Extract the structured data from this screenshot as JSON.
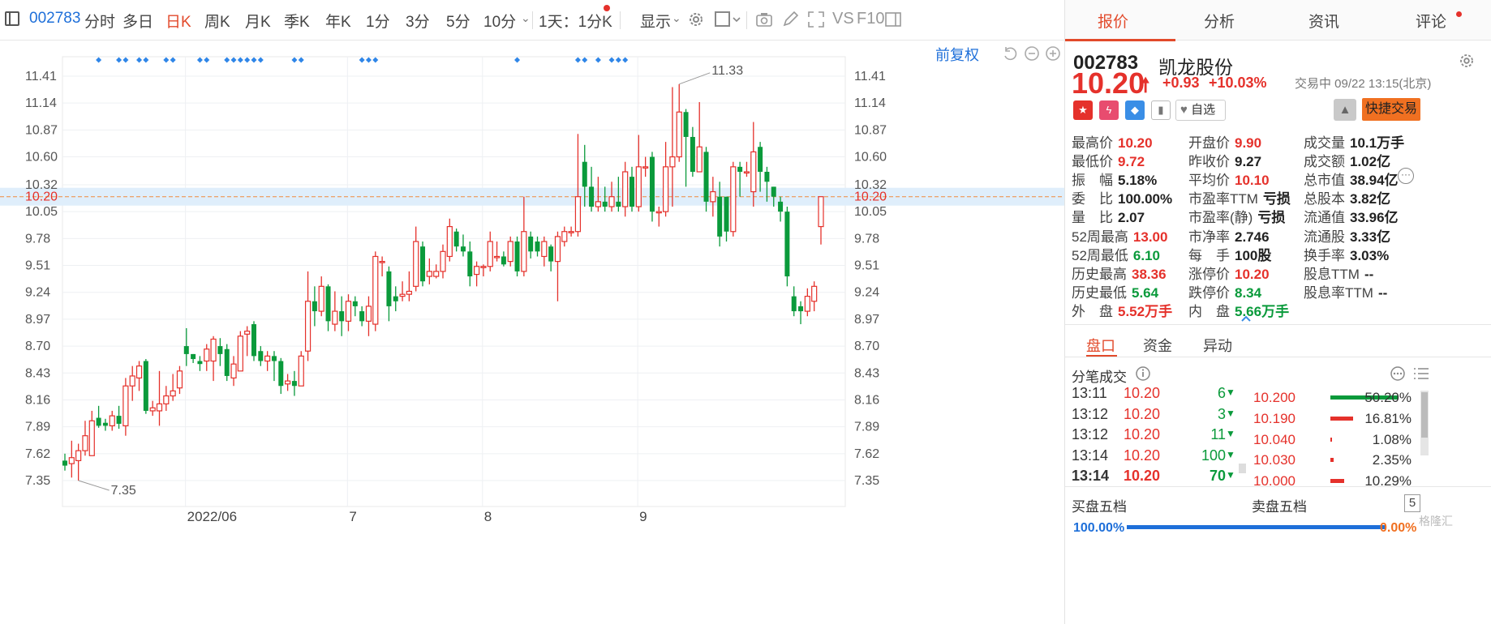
{
  "toolbar": {
    "code": "002783",
    "items": [
      "分时",
      "多日",
      "日K",
      "周K",
      "月K",
      "季K",
      "年K",
      "1分",
      "3分",
      "5分",
      "10分",
      "1天：1分K",
      "显示"
    ],
    "active": "日K",
    "vs_label": "VS",
    "f10_label": "F10",
    "adjust_label": "前复权"
  },
  "chart_data": {
    "type": "candlestick",
    "title": "",
    "y_ticks": [
      11.41,
      11.14,
      10.87,
      10.6,
      10.32,
      10.05,
      9.78,
      9.51,
      9.24,
      8.97,
      8.7,
      8.43,
      8.16,
      7.89,
      7.62,
      7.35
    ],
    "ylim": [
      7.22,
      11.58
    ],
    "x_labels": [
      "2022/06",
      "7",
      "8",
      "9"
    ],
    "current_price_line": 10.2,
    "high_annotation": "11.33",
    "low_annotation": "7.35",
    "grid": true,
    "candles": [
      [
        7.55,
        7.5,
        7.62,
        7.45
      ],
      [
        7.52,
        7.58,
        7.75,
        7.38
      ],
      [
        7.55,
        7.65,
        7.72,
        7.35
      ],
      [
        7.65,
        7.8,
        7.95,
        7.6
      ],
      [
        7.6,
        7.95,
        8.05,
        7.6
      ],
      [
        7.98,
        7.9,
        8.1,
        7.88
      ],
      [
        7.93,
        7.9,
        7.97,
        7.85
      ],
      [
        7.9,
        8.0,
        8.05,
        7.85
      ],
      [
        8.0,
        7.92,
        8.1,
        7.87
      ],
      [
        7.9,
        8.3,
        8.38,
        7.8
      ],
      [
        8.3,
        8.4,
        8.5,
        8.15
      ],
      [
        8.38,
        8.5,
        8.55,
        8.25
      ],
      [
        8.55,
        8.05,
        8.57,
        8.02
      ],
      [
        8.05,
        8.08,
        8.15,
        8.0
      ],
      [
        8.05,
        8.12,
        8.45,
        7.9
      ],
      [
        8.12,
        8.2,
        8.3,
        8.05
      ],
      [
        8.2,
        8.25,
        8.42,
        8.15
      ],
      [
        8.28,
        8.45,
        8.5,
        8.22
      ],
      [
        8.7,
        8.62,
        8.88,
        8.5
      ],
      [
        8.62,
        8.57,
        8.62,
        8.53
      ],
      [
        8.55,
        8.52,
        8.6,
        8.45
      ],
      [
        8.55,
        8.67,
        8.72,
        8.45
      ],
      [
        8.55,
        8.77,
        8.8,
        8.35
      ],
      [
        8.7,
        8.62,
        8.78,
        8.5
      ],
      [
        8.67,
        8.4,
        8.72,
        8.35
      ],
      [
        8.38,
        8.52,
        8.6,
        8.3
      ],
      [
        8.45,
        8.8,
        8.85,
        8.45
      ],
      [
        8.82,
        8.85,
        8.9,
        8.6
      ],
      [
        8.92,
        8.6,
        8.95,
        8.55
      ],
      [
        8.65,
        8.55,
        8.7,
        8.5
      ],
      [
        8.55,
        8.6,
        8.65,
        8.45
      ],
      [
        8.6,
        8.55,
        8.65,
        8.35
      ],
      [
        8.55,
        8.3,
        8.58,
        8.22
      ],
      [
        8.32,
        8.35,
        8.42,
        8.25
      ],
      [
        8.35,
        8.3,
        8.45,
        8.2
      ],
      [
        8.3,
        8.6,
        8.65,
        8.3
      ],
      [
        8.65,
        9.15,
        9.45,
        8.55
      ],
      [
        9.15,
        9.05,
        9.3,
        8.9
      ],
      [
        9.05,
        9.3,
        9.4,
        9.0
      ],
      [
        9.3,
        8.95,
        9.32,
        8.85
      ],
      [
        8.92,
        9.05,
        9.25,
        8.85
      ],
      [
        9.05,
        8.95,
        9.2,
        8.8
      ],
      [
        8.95,
        9.15,
        9.22,
        8.85
      ],
      [
        9.15,
        9.1,
        9.2,
        9.0
      ],
      [
        9.05,
        8.95,
        9.1,
        8.9
      ],
      [
        8.95,
        9.1,
        9.2,
        8.8
      ],
      [
        8.92,
        9.6,
        9.65,
        8.85
      ],
      [
        9.55,
        9.55,
        9.6,
        9.4
      ],
      [
        9.45,
        9.1,
        9.5,
        8.95
      ],
      [
        9.2,
        9.15,
        9.3,
        9.05
      ],
      [
        9.2,
        9.22,
        9.35,
        9.15
      ],
      [
        9.22,
        9.25,
        9.45,
        9.15
      ],
      [
        9.3,
        9.75,
        9.9,
        9.25
      ],
      [
        9.7,
        9.35,
        9.75,
        9.3
      ],
      [
        9.4,
        9.45,
        9.58,
        9.32
      ],
      [
        9.4,
        9.45,
        9.52,
        9.38
      ],
      [
        9.45,
        9.65,
        9.72,
        9.38
      ],
      [
        9.6,
        9.9,
        9.98,
        9.55
      ],
      [
        9.85,
        9.7,
        9.88,
        9.65
      ],
      [
        9.7,
        9.65,
        9.82,
        9.6
      ],
      [
        9.65,
        9.4,
        9.75,
        9.3
      ],
      [
        9.42,
        9.5,
        9.55,
        9.3
      ],
      [
        9.5,
        9.5,
        9.52,
        9.4
      ],
      [
        9.5,
        9.75,
        9.85,
        9.45
      ],
      [
        9.6,
        9.6,
        9.75,
        9.55
      ],
      [
        9.6,
        9.52,
        9.65,
        9.5
      ],
      [
        9.55,
        9.75,
        9.8,
        9.5
      ],
      [
        9.75,
        9.45,
        9.8,
        9.4
      ],
      [
        9.45,
        9.85,
        10.2,
        9.4
      ],
      [
        9.8,
        9.65,
        9.85,
        9.58
      ],
      [
        9.75,
        9.65,
        9.8,
        9.6
      ],
      [
        9.6,
        9.75,
        9.8,
        9.5
      ],
      [
        9.7,
        9.55,
        9.72,
        9.45
      ],
      [
        9.55,
        9.8,
        9.85,
        9.15
      ],
      [
        9.75,
        9.85,
        9.9,
        9.7
      ],
      [
        9.85,
        9.85,
        9.9,
        9.8
      ],
      [
        9.85,
        10.2,
        10.83,
        9.8
      ],
      [
        10.55,
        10.3,
        10.72,
        10.1
      ],
      [
        10.3,
        10.1,
        10.5,
        10.05
      ],
      [
        10.1,
        10.15,
        10.4,
        10.05
      ],
      [
        10.15,
        10.1,
        10.3,
        10.05
      ],
      [
        10.1,
        10.2,
        10.35,
        10.05
      ],
      [
        10.15,
        10.1,
        10.4,
        10.05
      ],
      [
        10.1,
        10.45,
        10.55,
        10.0
      ],
      [
        10.4,
        10.1,
        10.5,
        10.05
      ],
      [
        10.1,
        10.5,
        10.82,
        10.05
      ],
      [
        10.5,
        10.5,
        10.6,
        10.4
      ],
      [
        10.6,
        10.05,
        10.65,
        9.95
      ],
      [
        10.05,
        10.05,
        10.1,
        9.9
      ],
      [
        10.05,
        10.5,
        10.75,
        10.0
      ],
      [
        10.5,
        10.6,
        11.3,
        10.1
      ],
      [
        10.6,
        11.05,
        11.33,
        10.55
      ],
      [
        11.05,
        10.8,
        11.08,
        10.3
      ],
      [
        10.8,
        10.45,
        10.9,
        10.4
      ],
      [
        10.45,
        10.7,
        11.15,
        10.45
      ],
      [
        10.65,
        10.15,
        10.7,
        10.05
      ],
      [
        10.15,
        10.25,
        10.4,
        10.0
      ],
      [
        10.2,
        9.8,
        10.35,
        9.7
      ],
      [
        10.2,
        9.85,
        10.2,
        9.75
      ],
      [
        9.85,
        10.5,
        10.55,
        9.8
      ],
      [
        10.5,
        10.45,
        10.55,
        10.2
      ],
      [
        10.45,
        10.45,
        10.55,
        10.4
      ],
      [
        10.25,
        10.65,
        10.95,
        10.1
      ],
      [
        10.7,
        10.45,
        10.75,
        10.25
      ],
      [
        10.45,
        10.35,
        10.5,
        10.15
      ],
      [
        10.3,
        10.2,
        10.3,
        10.1
      ],
      [
        10.15,
        10.05,
        10.2,
        9.95
      ],
      [
        10.05,
        9.4,
        10.1,
        9.3
      ],
      [
        9.2,
        9.05,
        9.3,
        9.0
      ],
      [
        9.1,
        9.05,
        9.15,
        8.92
      ],
      [
        9.05,
        9.2,
        9.28,
        9.0
      ],
      [
        9.15,
        9.3,
        9.35,
        9.05
      ],
      [
        9.9,
        10.2,
        10.2,
        9.72
      ]
    ]
  },
  "stock": {
    "code": "002783",
    "name": "凯龙股份",
    "price": "10.20",
    "change": "+0.93",
    "change_pct": "+10.03%",
    "status": "交易中 09/22 13:15(北京)",
    "watch_label": "自选",
    "trade_label": "快捷交易",
    "colors": {
      "up": "#e5312b",
      "down": "#0a9a3b",
      "accent": "#e24a2b"
    }
  },
  "panel_tabs": [
    "报价",
    "分析",
    "资讯",
    "评论"
  ],
  "stats": [
    [
      [
        "最高价",
        "10.20",
        "red"
      ],
      [
        "开盘价",
        "9.90",
        "red"
      ],
      [
        "成交量",
        "10.1万手",
        "dark"
      ]
    ],
    [
      [
        "最低价",
        "9.72",
        "red"
      ],
      [
        "昨收价",
        "9.27",
        "dark"
      ],
      [
        "成交额",
        "1.02亿",
        "dark"
      ]
    ],
    [
      [
        "振　幅",
        "5.18%",
        "dark"
      ],
      [
        "平均价",
        "10.10",
        "red"
      ],
      [
        "总市值",
        "38.94亿",
        "dark"
      ]
    ],
    [
      [
        "委　比",
        "100.00%",
        "dark"
      ],
      [
        "市盈率TTM",
        "亏损",
        "dark"
      ],
      [
        "总股本",
        "3.82亿",
        "dark"
      ]
    ],
    [
      [
        "量　比",
        "2.07",
        "dark"
      ],
      [
        "市盈率(静)",
        "亏损",
        "dark"
      ],
      [
        "流通值",
        "33.96亿",
        "dark"
      ]
    ],
    [
      [
        "52周最高",
        "13.00",
        "red"
      ],
      [
        "市净率",
        "2.746",
        "dark"
      ],
      [
        "流通股",
        "3.33亿",
        "dark"
      ]
    ],
    [
      [
        "52周最低",
        "6.10",
        "green"
      ],
      [
        "每　手",
        "100股",
        "dark"
      ],
      [
        "换手率",
        "3.03%",
        "dark"
      ]
    ],
    [
      [
        "历史最高",
        "38.36",
        "red"
      ],
      [
        "涨停价",
        "10.20",
        "red"
      ],
      [
        "股息TTM",
        "--",
        "dark"
      ]
    ],
    [
      [
        "历史最低",
        "5.64",
        "green"
      ],
      [
        "跌停价",
        "8.34",
        "green"
      ],
      [
        "股息率TTM",
        "--",
        "dark"
      ]
    ],
    [
      [
        "外　盘",
        "5.52万手",
        "red"
      ],
      [
        "内　盘",
        "5.66万手",
        "green"
      ]
    ]
  ],
  "sub_tabs": [
    "盘口",
    "资金",
    "异动"
  ],
  "ticks_title": "分笔成交",
  "ticks": [
    {
      "time": "13:11",
      "price": "10.20",
      "vol": "6"
    },
    {
      "time": "13:12",
      "price": "10.20",
      "vol": "3"
    },
    {
      "time": "13:12",
      "price": "10.20",
      "vol": "11"
    },
    {
      "time": "13:14",
      "price": "10.20",
      "vol": "100"
    },
    {
      "time": "13:14",
      "price": "10.20",
      "vol": "70"
    }
  ],
  "dist": [
    {
      "price": "10.200",
      "pct": "50.20%",
      "ratio": 0.502
    },
    {
      "price": "10.190",
      "pct": "16.81%",
      "ratio": 0.1681
    },
    {
      "price": "10.040",
      "pct": "1.08%",
      "ratio": 0.0108
    },
    {
      "price": "10.030",
      "pct": "2.35%",
      "ratio": 0.0235
    },
    {
      "price": "10.000",
      "pct": "10.29%",
      "ratio": 0.1029
    }
  ],
  "book": {
    "buy_label": "买盘五档",
    "sell_label": "卖盘五档",
    "levels": "5",
    "buy_pct": "100.00%",
    "sell_pct": "0.00%"
  },
  "watermark": "格隆汇"
}
